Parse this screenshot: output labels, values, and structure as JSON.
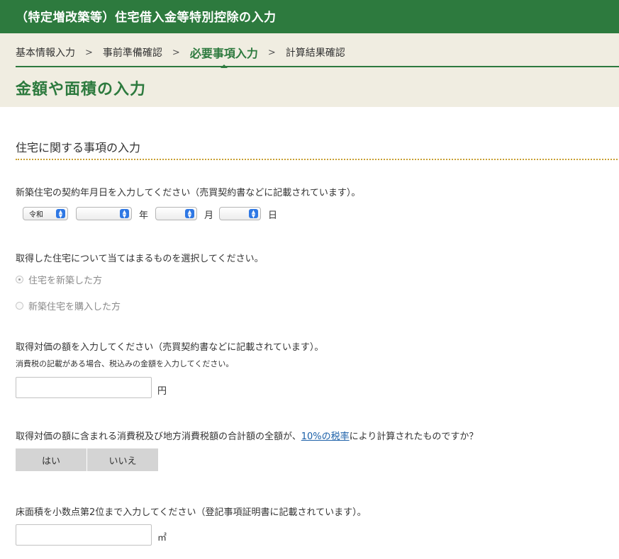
{
  "header": {
    "title": "（特定増改築等）住宅借入金等特別控除の入力"
  },
  "steps": [
    "基本情報入力",
    "事前準備確認",
    "必要事項入力",
    "計算結果確認"
  ],
  "step_separator": ">",
  "page_title": "金額や面積の入力",
  "section_title": "住宅に関する事項の入力",
  "contract_date": {
    "question": "新築住宅の契約年月日を入力してください（売買契約書などに記載されています）。",
    "era_value": "令和",
    "year_unit": "年",
    "month_unit": "月",
    "day_unit": "日"
  },
  "acquisition_type": {
    "question": "取得した住宅について当てはまるものを選択してください。",
    "options": [
      "住宅を新築した方",
      "新築住宅を購入した方"
    ]
  },
  "price": {
    "question": "取得対価の額を入力してください（売買契約書などに記載されています）。",
    "note": "消費税の記載がある場合、税込みの金額を入力してください。",
    "unit": "円"
  },
  "tax_rate": {
    "question_before": "取得対価の額に含まれる消費税及び地方消費税額の合計額の全額が、",
    "question_link": "10%の税率",
    "question_after": "により計算されたものですか？",
    "yes_label": "はい",
    "no_label": "いいえ"
  },
  "floor_area": {
    "question": "床面積を小数点第2位まで入力してください（登記事項証明書に記載されています）。",
    "unit": "㎡"
  },
  "colors": {
    "brand": "#2d7a3e",
    "beige": "#f0ede1",
    "accent_dotted": "#c8a032",
    "link": "#1a5fa8"
  }
}
